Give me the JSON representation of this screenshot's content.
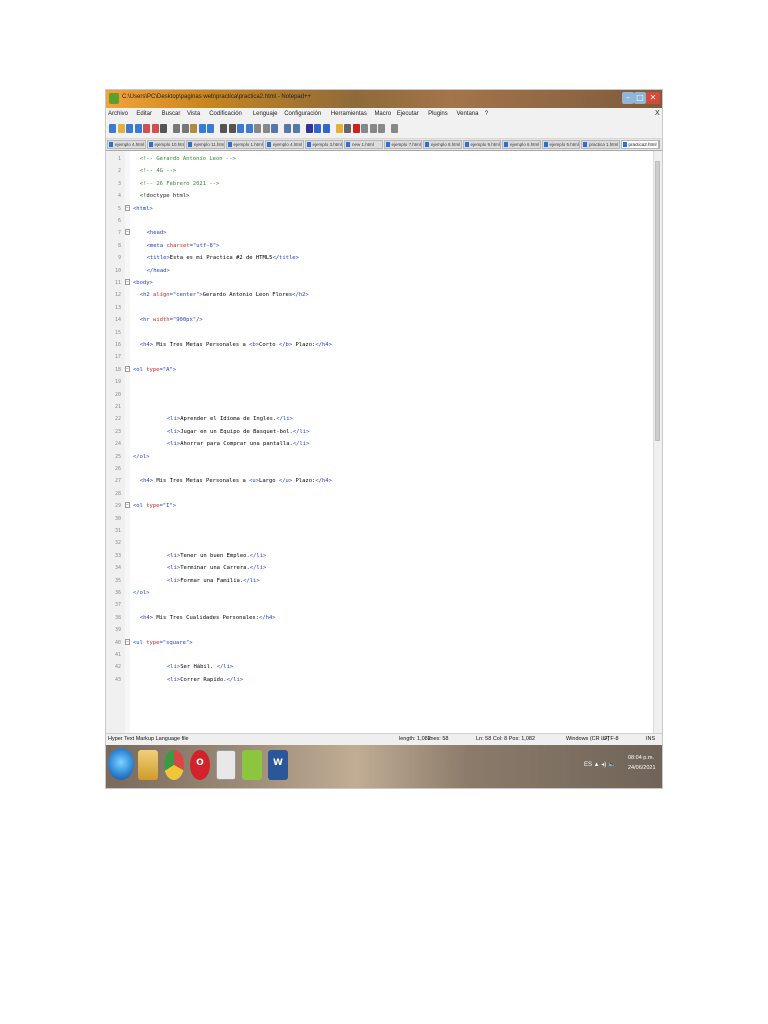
{
  "window": {
    "title": "C:\\Users\\PC\\Desktop\\paginas web\\practica\\practica2.html - Notepad++",
    "buttons": {
      "minimize": "–",
      "maximize": "□",
      "close": "✕"
    }
  },
  "menu": {
    "items": [
      "Archivo",
      "Editar",
      "Buscar",
      "Vista",
      "Codificación",
      "Lenguaje",
      "Configuración",
      "Herramientas",
      "Macro",
      "Ejecutar",
      "Plugins",
      "Ventana",
      "?"
    ],
    "close": "X"
  },
  "toolbar": {
    "icon_names": [
      "new-file-icon",
      "open-file-icon",
      "save-icon",
      "save-all-icon",
      "close-icon",
      "close-all-icon",
      "print-icon",
      "cut-icon",
      "copy-icon",
      "paste-icon",
      "undo-icon",
      "redo-icon",
      "find-icon",
      "replace-icon",
      "zoom-in-icon",
      "zoom-out-icon",
      "sync-v-icon",
      "sync-h-icon",
      "wrap-icon",
      "all-chars-icon",
      "indent-guide-icon",
      "lang-icon",
      "doc-map-icon",
      "function-list-icon",
      "folder-workspace-icon",
      "monitor-icon",
      "record-macro-icon",
      "stop-macro-icon",
      "play-macro-icon",
      "run-macro-icon",
      "save-macro-icon"
    ],
    "icon_colors": [
      "#3a7bd5",
      "#e2b13c",
      "#3a7bd5",
      "#3a7bd5",
      "#d05050",
      "#d05050",
      "#555555",
      "#777777",
      "#777777",
      "#b08a3e",
      "#3a7bd5",
      "#3a7bd5",
      "#555555",
      "#555555",
      "#3a7bd5",
      "#3a7bd5",
      "#888888",
      "#888888",
      "#5577aa",
      "#5577aa",
      "#5577aa",
      "#333399",
      "#3366cc",
      "#3366cc",
      "#e2b13c",
      "#666666",
      "#d02020",
      "#888888",
      "#888888",
      "#888888",
      "#888888"
    ]
  },
  "tabs": {
    "items": [
      "ejemplo 4.html",
      "ejemplo 10.html",
      "ejemplo 11.html",
      "ejemplo 1.html",
      "ejemplo 4.html",
      "ejemplo 3.html",
      "new 1.html",
      "ejemplo 7.html",
      "ejemplo 8.html",
      "ejemplo 9.html",
      "ejemplo 6.html",
      "ejemplo 5.html",
      "practica 1.html",
      "practica2.html"
    ],
    "active_index": 13,
    "nav": "◂▸"
  },
  "editor": {
    "lines": [
      {
        "n": "1",
        "fold": "",
        "parts": [
          {
            "c": "comment",
            "t": "<!-- Gerardo Antonio Leon -->"
          }
        ],
        "indent": 2
      },
      {
        "n": "2",
        "fold": "",
        "parts": [
          {
            "c": "comment",
            "t": "<!-- 4G -->"
          }
        ],
        "indent": 2
      },
      {
        "n": "3",
        "fold": "",
        "parts": [
          {
            "c": "comment",
            "t": "<!-- 26 Febrero 2021 -->"
          }
        ],
        "indent": 2
      },
      {
        "n": "4",
        "fold": "",
        "parts": [
          {
            "c": "doctype",
            "t": "<!doctype html>"
          }
        ],
        "indent": 2
      },
      {
        "n": "5",
        "fold": "−",
        "parts": [
          {
            "c": "tag",
            "t": "<html>"
          }
        ],
        "indent": 0
      },
      {
        "n": "6",
        "fold": "",
        "parts": [],
        "indent": 0
      },
      {
        "n": "7",
        "fold": "−",
        "parts": [
          {
            "c": "tag",
            "t": "<head>"
          }
        ],
        "indent": 4
      },
      {
        "n": "8",
        "fold": "",
        "parts": [
          {
            "c": "tag",
            "t": "<meta "
          },
          {
            "c": "attr",
            "t": "charset"
          },
          {
            "c": "tag",
            "t": "=\"utf-8\">"
          }
        ],
        "indent": 4
      },
      {
        "n": "9",
        "fold": "",
        "parts": [
          {
            "c": "tag",
            "t": "<title>"
          },
          {
            "c": "text",
            "t": "Esta es mi Practica #2 de HTML5"
          },
          {
            "c": "tag",
            "t": "</title>"
          }
        ],
        "indent": 4
      },
      {
        "n": "10",
        "fold": "",
        "parts": [
          {
            "c": "tag",
            "t": "</head>"
          }
        ],
        "indent": 4
      },
      {
        "n": "11",
        "fold": "−",
        "parts": [
          {
            "c": "tag",
            "t": "<body>"
          }
        ],
        "indent": 0
      },
      {
        "n": "12",
        "fold": "",
        "parts": [
          {
            "c": "tag",
            "t": "<h2 "
          },
          {
            "c": "attr",
            "t": "align"
          },
          {
            "c": "tag",
            "t": "=\"center\">"
          },
          {
            "c": "text",
            "t": "Gerardo Antonio Leon Flores"
          },
          {
            "c": "tag",
            "t": "</h2>"
          }
        ],
        "indent": 2
      },
      {
        "n": "13",
        "fold": "",
        "parts": [],
        "indent": 0
      },
      {
        "n": "14",
        "fold": "",
        "parts": [
          {
            "c": "tag",
            "t": "<hr "
          },
          {
            "c": "attr",
            "t": "width"
          },
          {
            "c": "tag",
            "t": "=\"900px\"/>"
          }
        ],
        "indent": 2
      },
      {
        "n": "15",
        "fold": "",
        "parts": [],
        "indent": 0
      },
      {
        "n": "16",
        "fold": "",
        "parts": [
          {
            "c": "tag",
            "t": "<h4> "
          },
          {
            "c": "text",
            "t": "Mis Tres Metas Personales a "
          },
          {
            "c": "tag",
            "t": "<b>"
          },
          {
            "c": "text",
            "t": "Corto "
          },
          {
            "c": "tag",
            "t": "</b> "
          },
          {
            "c": "text",
            "t": "Plazo:"
          },
          {
            "c": "tag",
            "t": "</h4>"
          }
        ],
        "indent": 2
      },
      {
        "n": "17",
        "fold": "",
        "parts": [],
        "indent": 0
      },
      {
        "n": "18",
        "fold": "−",
        "parts": [
          {
            "c": "tag",
            "t": "<ol "
          },
          {
            "c": "attr",
            "t": "type"
          },
          {
            "c": "tag",
            "t": "=\"A\">"
          }
        ],
        "indent": 0
      },
      {
        "n": "19",
        "fold": "",
        "parts": [],
        "indent": 0
      },
      {
        "n": "20",
        "fold": "",
        "parts": [],
        "indent": 0
      },
      {
        "n": "21",
        "fold": "",
        "parts": [],
        "indent": 0
      },
      {
        "n": "22",
        "fold": "",
        "parts": [
          {
            "c": "tag",
            "t": "<li>"
          },
          {
            "c": "text",
            "t": "Aprender el Idioma de Ingles."
          },
          {
            "c": "tag",
            "t": "</li>"
          }
        ],
        "indent": 10
      },
      {
        "n": "23",
        "fold": "",
        "parts": [
          {
            "c": "tag",
            "t": "<li>"
          },
          {
            "c": "text",
            "t": "Jugar en un Equipo de Basquet-bol."
          },
          {
            "c": "tag",
            "t": "</li>"
          }
        ],
        "indent": 10
      },
      {
        "n": "24",
        "fold": "",
        "parts": [
          {
            "c": "tag",
            "t": "<li>"
          },
          {
            "c": "text",
            "t": "Ahorrar para Comprar una pantalla."
          },
          {
            "c": "tag",
            "t": "</li>"
          }
        ],
        "indent": 10
      },
      {
        "n": "25",
        "fold": "",
        "parts": [
          {
            "c": "tag",
            "t": "</ol>"
          }
        ],
        "indent": 0
      },
      {
        "n": "26",
        "fold": "",
        "parts": [],
        "indent": 0
      },
      {
        "n": "27",
        "fold": "",
        "parts": [
          {
            "c": "tag",
            "t": "<h4> "
          },
          {
            "c": "text",
            "t": "Mis Tres Metas Personales a "
          },
          {
            "c": "tag",
            "t": "<u>"
          },
          {
            "c": "text",
            "t": "Largo "
          },
          {
            "c": "tag",
            "t": "</u> "
          },
          {
            "c": "text",
            "t": "Plazo:"
          },
          {
            "c": "tag",
            "t": "</h4>"
          }
        ],
        "indent": 2
      },
      {
        "n": "28",
        "fold": "",
        "parts": [],
        "indent": 0
      },
      {
        "n": "29",
        "fold": "−",
        "parts": [
          {
            "c": "tag",
            "t": "<ol "
          },
          {
            "c": "attr",
            "t": "type"
          },
          {
            "c": "tag",
            "t": "=\"I\">"
          }
        ],
        "indent": 0
      },
      {
        "n": "30",
        "fold": "",
        "parts": [],
        "indent": 0
      },
      {
        "n": "31",
        "fold": "",
        "parts": [],
        "indent": 0
      },
      {
        "n": "32",
        "fold": "",
        "parts": [],
        "indent": 0
      },
      {
        "n": "33",
        "fold": "",
        "parts": [
          {
            "c": "tag",
            "t": "<li>"
          },
          {
            "c": "text",
            "t": "Tener un buen Empleo."
          },
          {
            "c": "tag",
            "t": "</li>"
          }
        ],
        "indent": 10
      },
      {
        "n": "34",
        "fold": "",
        "parts": [
          {
            "c": "tag",
            "t": "<li>"
          },
          {
            "c": "text",
            "t": "Terminar una Carrera."
          },
          {
            "c": "tag",
            "t": "</li>"
          }
        ],
        "indent": 10
      },
      {
        "n": "35",
        "fold": "",
        "parts": [
          {
            "c": "tag",
            "t": "<li>"
          },
          {
            "c": "text",
            "t": "Formar una Familia."
          },
          {
            "c": "tag",
            "t": "</li>"
          }
        ],
        "indent": 10
      },
      {
        "n": "36",
        "fold": "",
        "parts": [
          {
            "c": "tag",
            "t": "</ol>"
          }
        ],
        "indent": 0
      },
      {
        "n": "37",
        "fold": "",
        "parts": [],
        "indent": 0
      },
      {
        "n": "38",
        "fold": "",
        "parts": [
          {
            "c": "tag",
            "t": "<h4> "
          },
          {
            "c": "text",
            "t": "Mis Tres Cualidades Personales:"
          },
          {
            "c": "tag",
            "t": "</h4>"
          }
        ],
        "indent": 2
      },
      {
        "n": "39",
        "fold": "",
        "parts": [],
        "indent": 0
      },
      {
        "n": "40",
        "fold": "−",
        "parts": [
          {
            "c": "tag",
            "t": "<ul "
          },
          {
            "c": "attr",
            "t": "type"
          },
          {
            "c": "tag",
            "t": "=\"square\">"
          }
        ],
        "indent": 0
      },
      {
        "n": "41",
        "fold": "",
        "parts": [],
        "indent": 0
      },
      {
        "n": "42",
        "fold": "",
        "parts": [
          {
            "c": "tag",
            "t": "<li>"
          },
          {
            "c": "text",
            "t": "Ser Hábil. "
          },
          {
            "c": "tag",
            "t": "</li>"
          }
        ],
        "indent": 10
      },
      {
        "n": "43",
        "fold": "",
        "parts": [
          {
            "c": "tag",
            "t": "<li>"
          },
          {
            "c": "text",
            "t": "Correr Rapido."
          },
          {
            "c": "tag",
            "t": "</li>"
          }
        ],
        "indent": 10
      }
    ]
  },
  "status": {
    "language": "Hyper Text Markup Language file",
    "length": "length: 1,082",
    "lines": "lines: 58",
    "position": "Ln: 58   Col: 8   Pos: 1,082",
    "eol": "Windows (CR LF)",
    "encoding": "UTF-8",
    "mode": "INS"
  },
  "taskbar": {
    "apps": [
      "start-button",
      "file-explorer-icon",
      "chrome-icon",
      "opera-icon",
      "notepad-icon",
      "notepad-plus-plus-icon",
      "word-icon"
    ],
    "tray": "ES  ▲  ◂) 🔈",
    "time": "08:04 p.m.",
    "date": "24/06/2021"
  }
}
